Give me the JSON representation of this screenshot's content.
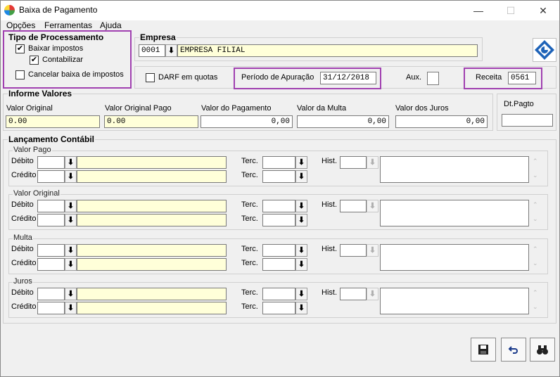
{
  "window": {
    "title": "Baixa de Pagamento",
    "minimize": "—",
    "maximize": "☐",
    "close": "✕"
  },
  "menu": [
    "Opções",
    "Ferramentas",
    "Ajuda"
  ],
  "tipo": {
    "label": "Tipo de Processamento",
    "baixar_impostos": "Baixar impostos",
    "contabilizar": "Contabilizar",
    "cancelar": "Cancelar baixa de impostos",
    "baixar_checked": "✔",
    "contabilizar_checked": "✔"
  },
  "empresa": {
    "label": "Empresa",
    "code": "0001",
    "name": "EMPRESA FILIAL"
  },
  "darf": {
    "label": "DARF em quotas"
  },
  "periodo": {
    "label": "Período de Apuração",
    "value": "31/12/2018"
  },
  "aux": {
    "label": "Aux."
  },
  "receita": {
    "label": "Receita",
    "value": "0561"
  },
  "valores": {
    "label": "Informe Valores",
    "original_label": "Valor Original",
    "original": "0.00",
    "original_pago_label": "Valor Original Pago",
    "original_pago": "0.00",
    "pagamento_label": "Valor do Pagamento",
    "pagamento": "0,00",
    "multa_label": "Valor da Multa",
    "multa": "0,00",
    "juros_label": "Valor dos Juros",
    "juros": "0,00"
  },
  "dtpagto": {
    "label": "Dt.Pagto",
    "value": ""
  },
  "lancamento": {
    "label": "Lançamento Contábil",
    "debito": "Débito",
    "credito": "Crédito",
    "terc": "Terc.",
    "hist": "Hist.",
    "sections": [
      "Valor Pago",
      "Valor Original",
      "Multa",
      "Juros"
    ]
  },
  "icons": {
    "drop": "⬇",
    "save": "save-icon",
    "undo": "undo-icon",
    "find": "binoculars-icon"
  }
}
